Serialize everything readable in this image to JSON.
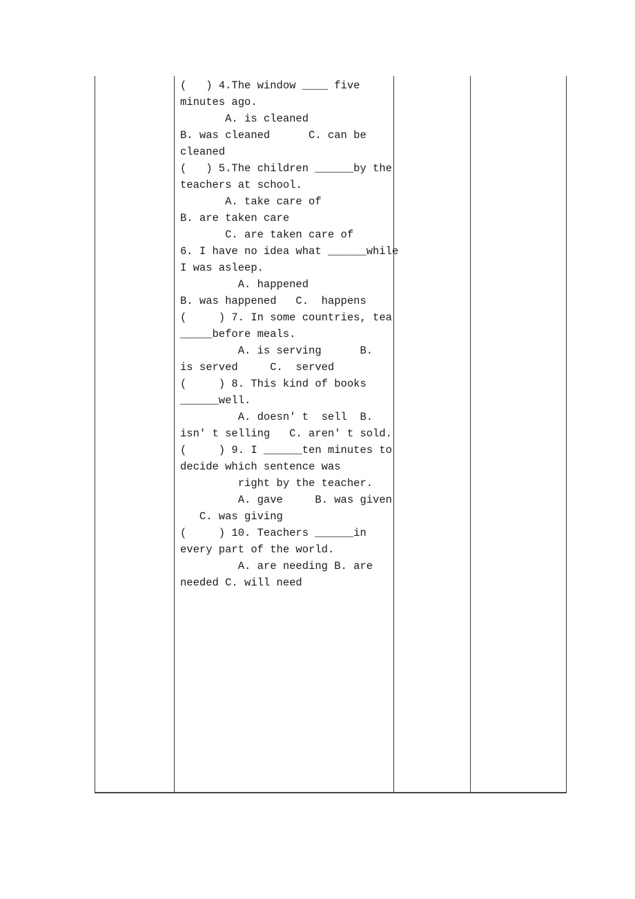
{
  "document": {
    "type": "worksheet-table",
    "columns": 4,
    "exercise_cell": {
      "lines": [
        "(   ) 4.The window ____ five",
        "minutes ago.",
        "       A. is cleaned",
        "B. was cleaned      C. can be",
        "cleaned",
        "(   ) 5.The children ______by the",
        "teachers at school.",
        "       A. take care of",
        "B. are taken care",
        "       C. are taken care of",
        "6. I have no idea what ______while",
        "I was asleep.",
        "         A. happened",
        "B. was happened   C.  happens",
        "(     ) 7. In some countries, tea",
        "_____before meals.",
        "         A. is serving      B.",
        "is served     C.  served",
        "(     ) 8. This kind of books",
        "______well.",
        "         A. doesn' t  sell  B.",
        "isn' t selling   C. aren' t sold.",
        "(     ) 9. I ______ten minutes to",
        "decide which sentence was",
        "         right by the teacher.",
        "         A. gave     B. was given",
        "   C. was giving",
        "(     ) 10. Teachers ______in",
        "every part of the world.",
        "         A. are needing B. are",
        "needed C. will need"
      ]
    }
  }
}
